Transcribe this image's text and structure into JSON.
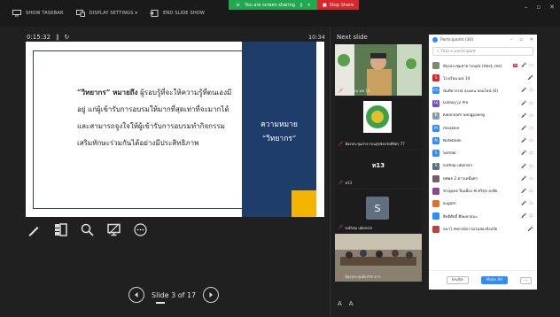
{
  "toolbar": {
    "show_taskbar": "SHOW TASKBAR",
    "display_settings": "DISPLAY SETTINGS ▾",
    "end_slide_show": "END SLIDE SHOW"
  },
  "share_banner": {
    "text": "You are screen sharing",
    "stop": "Stop Share"
  },
  "presenter": {
    "timer": "0:15:32",
    "clock": "10:34",
    "next_slide_label": "Next slide"
  },
  "slide": {
    "line1_term": "“วิทยากร” หมายถึง",
    "line1_rest": " ผู้รอบรู้ที่จะให้ความรู้ที่ตนเองมี",
    "line2": "อยู่ แก่ผู้เข้ารับการอบรมให้มากที่สุดเท่าที่จะมากได้",
    "line3": "และสามารถจูงใจให้ผู้เข้ารับการอบรมทำกิจกรรม",
    "line4": "เสริมทักษะร่วมกันได้อย่างมีประสิทธิภาพ",
    "panel_line1": "ความหมาย",
    "panel_line2": "“วิทยากร”"
  },
  "slide_nav": {
    "text": "Slide 3 of 17"
  },
  "gallery": {
    "tile1_name": "โรงเรียน wa 14",
    "tile2_name": "ห้องประชุมสาธารณสุขจังหวัดพิจิตร 77",
    "tile3_label": "ท13",
    "tile3_name": "ท13",
    "tile4_avatar": "S",
    "tile4_name": "suthep ubonsin",
    "tile5_name": "ห้องประชุมห้องวิชาการ"
  },
  "zoom_labels": {
    "a_large": "A",
    "a_small": "A"
  },
  "participants": {
    "title": "Participants (30)",
    "search_placeholder": "Find a participant",
    "rows": [
      {
        "avatar": "",
        "color": "#7a8a6a",
        "name": "ห้องประชุมสาธารณสุข (Host, me)",
        "badge": "M",
        "mic": "🎤",
        "cam": "▭"
      },
      {
        "avatar": "S",
        "color": "#d8262b",
        "name": "โรงเรียน wa 14",
        "badge": "",
        "mic": "🎤",
        "cam": ""
      },
      {
        "avatar": "Ch",
        "color": "#2d8cff",
        "name": "นันทิยากรณ์ ลุงแดน ออนไลน์ (มี)",
        "badge": "",
        "mic": "🎤",
        "cam": "▭"
      },
      {
        "avatar": "GJ",
        "color": "#6f4fd0",
        "name": "Galaxy J2 Pro",
        "badge": "",
        "mic": "🎤",
        "cam": "▭"
      },
      {
        "avatar": "K",
        "color": "#889aa8",
        "name": "Kwannam Sangpaeng",
        "badge": "",
        "mic": "🎤",
        "cam": "▭"
      },
      {
        "avatar": "M",
        "color": "#2d8cff",
        "name": "mookkie",
        "badge": "",
        "mic": "🎤",
        "cam": "▭"
      },
      {
        "avatar": "N",
        "color": "#2d8cff",
        "name": "Notebook",
        "badge": "",
        "mic": "🎤",
        "cam": "▭"
      },
      {
        "avatar": "S",
        "color": "#2d8cff",
        "name": "Somak",
        "badge": "",
        "mic": "🎤",
        "cam": "▭"
      },
      {
        "avatar": "S",
        "color": "#5f6f7f",
        "name": "suthep ubonsin",
        "badge": "",
        "mic": "🎤",
        "cam": "▭"
      },
      {
        "avatar": "",
        "color": "#7a5a6a",
        "name": "ทศพล 2 ดาวเหนือศา",
        "badge": "",
        "mic": "🎤",
        "cam": "▭"
      },
      {
        "avatar": "",
        "color": "#8a4a8a",
        "name": "ชาญยุทธ ปิ่นเมือง ฑ์ ศรีสุข ลุงชัย",
        "badge": "",
        "mic": "🎤",
        "cam": "▭"
      },
      {
        "avatar": "",
        "color": "#e07030",
        "name": "sugam",
        "badge": "",
        "mic": "🎤",
        "cam": "▭"
      },
      {
        "avatar": "",
        "color": "#2d8cff",
        "name": "สิทธิศักดิ์ ศิลมหาธนะ",
        "badge": "",
        "mic": "🎤",
        "cam": "▭"
      },
      {
        "avatar": "",
        "color": "#c04040",
        "name": "อนาไ สหกรณ์กรามวนสองจังหวัด",
        "badge": "",
        "mic": "🎤",
        "cam": ""
      }
    ],
    "invite": "Invite",
    "mute_all": "Mute All",
    "more": "···"
  }
}
